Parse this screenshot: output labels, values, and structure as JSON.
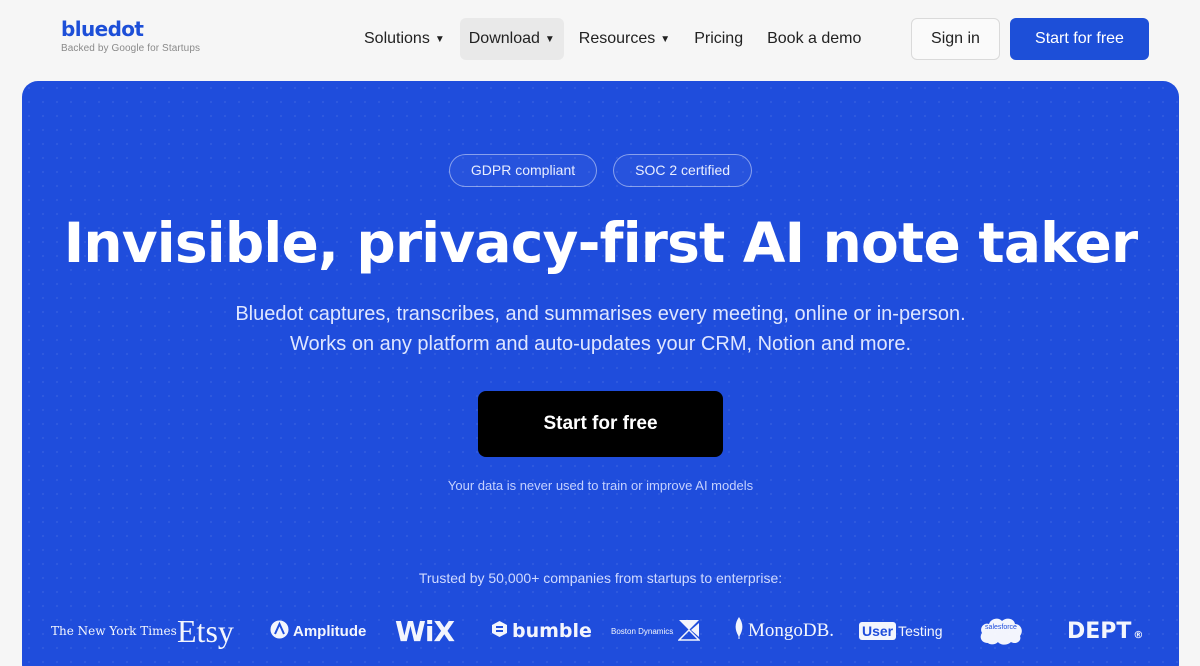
{
  "brand": {
    "name": "bluedot",
    "tagline": "Backed by Google for Startups"
  },
  "nav": {
    "links": [
      {
        "label": "Solutions",
        "caret": "▼"
      },
      {
        "label": "Download",
        "caret": "▼"
      },
      {
        "label": "Resources",
        "caret": "▼"
      },
      {
        "label": "Pricing"
      },
      {
        "label": "Book a demo"
      }
    ],
    "sign_in": "Sign in",
    "start": "Start for free"
  },
  "hero": {
    "badges": [
      "GDPR compliant",
      "SOC 2 certified"
    ],
    "headline": "Invisible, privacy-first AI note taker",
    "sub_line1": "Bluedot captures, transcribes, and summarises every meeting, online or in-person.",
    "sub_line2": "Works on any platform and auto-updates your CRM, Notion and more.",
    "cta": "Start for free",
    "note": "Your data is never used to train or improve AI models",
    "trusted": "Trusted by 50,000+ companies from startups to enterprise:"
  },
  "logos": [
    {
      "name": "The New York Times"
    },
    {
      "name": "Etsy"
    },
    {
      "name": "Amplitude"
    },
    {
      "name": "WiX"
    },
    {
      "name": "bumble"
    },
    {
      "name": "Boston Dynamics"
    },
    {
      "name": "MongoDB."
    },
    {
      "name_part1": "User",
      "name_part2": "Testing"
    },
    {
      "name": "salesforce"
    },
    {
      "name": "DEPT",
      "mark": "®"
    }
  ],
  "colors": {
    "brand_blue": "#1d4fd8",
    "hero_blue": "#1f4ddc",
    "cta_black": "#000000"
  }
}
